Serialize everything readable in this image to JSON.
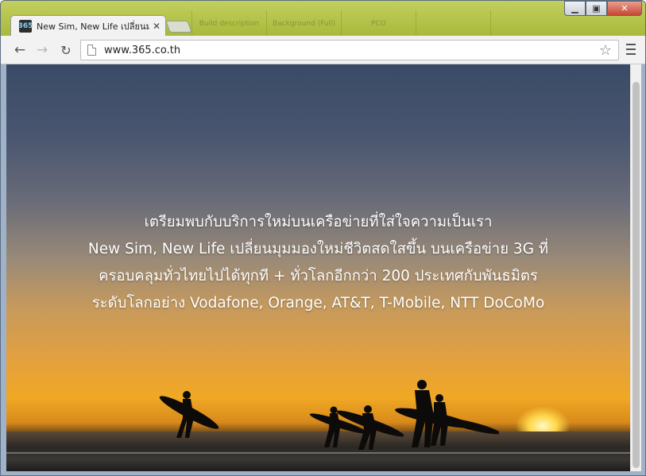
{
  "browser": {
    "tab_title": "New Sim, New Life เปลี่ยนมุ",
    "tab_favicon_text": "365",
    "url": "www.365.co.th",
    "background_page_cells": [
      "Build description",
      "Background (Full)",
      "PCO",
      "",
      ""
    ]
  },
  "hero": {
    "lines": [
      "เตรียมพบกับบริการใหม่บนเครือข่ายที่ใส่ใจความเป็นเรา",
      "New Sim, New Life เปลี่ยนมุมมองใหม่ชีวิตสดใสขึ้น บนเครือข่าย 3G ที่",
      "ครอบคลุมทั่วไทยไปได้ทุกที + ทั่วโลกอีกกว่า 200 ประเทศกับพันธมิตร",
      "ระดับโลกอย่าง Vodafone, Orange, AT&T, T-Mobile, NTT DoCoMo"
    ]
  },
  "icons": {
    "back": "back-arrow-icon",
    "forward": "forward-arrow-icon",
    "reload": "reload-icon",
    "page": "page-icon",
    "star": "star-icon",
    "menu": "menu-icon",
    "close": "close-icon"
  },
  "colors": {
    "tabstrip": "#b3c24a",
    "text": "#ffffff",
    "window_close": "#c74632"
  }
}
